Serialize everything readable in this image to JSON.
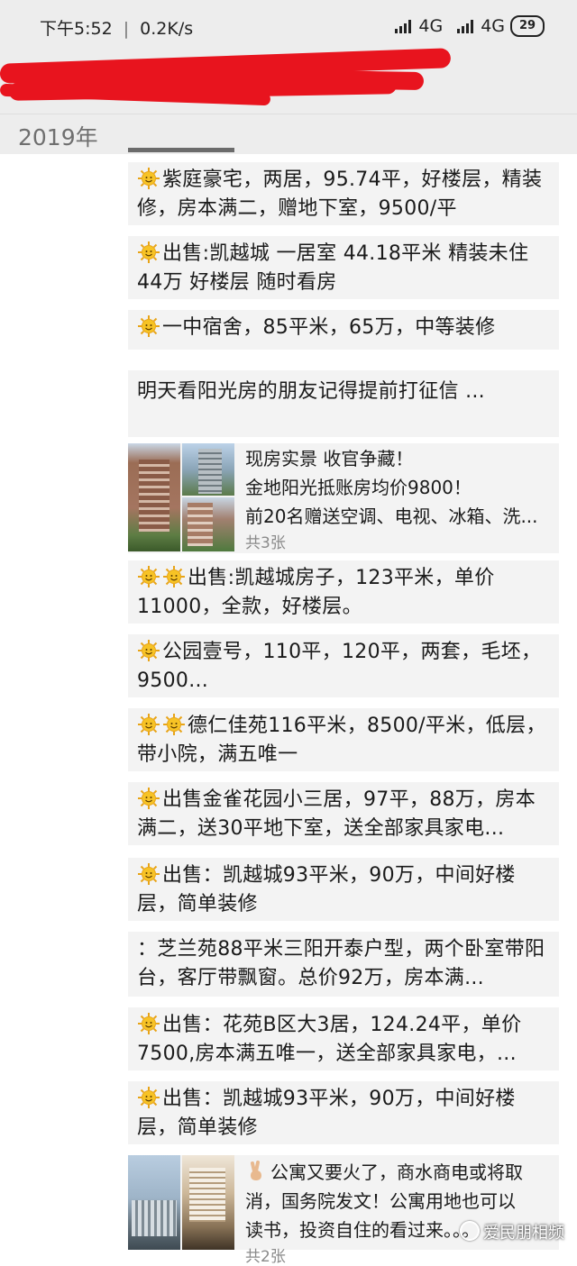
{
  "status_bar": {
    "time": "下午5:52",
    "speed": "0.2K/s",
    "network1": "4G",
    "network2": "4G",
    "battery": "29"
  },
  "year_label": "2019年",
  "posts": [
    {
      "icon": "sun-emoji",
      "icon_count": 1,
      "text": "紫庭豪宅，两居，95.74平，好楼层，精装修，房本满二，赠地下室，9500/平"
    },
    {
      "icon": "sun-emoji",
      "icon_count": 1,
      "text": "出售:凯越城 一居室  44.18平米  精装未住   44万   好楼层   随时看房"
    },
    {
      "icon": "sun-emoji",
      "icon_count": 1,
      "text": "一中宿舍，85平米，65万，中等装修"
    },
    {
      "icon": "",
      "icon_count": 0,
      "text": "明天看阳光房的朋友记得提前打征信 ..."
    },
    {
      "icon": "sun-emoji",
      "icon_count": 2,
      "text": "出售:凯越城房子，123平米，单价11000，全款，好楼层。"
    },
    {
      "icon": "sun-emoji",
      "icon_count": 1,
      "text": "公园壹号，110平，120平，两套，毛坯，9500..."
    },
    {
      "icon": "sun-emoji",
      "icon_count": 2,
      "text": "德仁佳苑116平米，8500/平米，低层，带小院，满五唯一"
    },
    {
      "icon": "sun-emoji",
      "icon_count": 1,
      "text": "出售金雀花园小三居，97平，88万，房本满二，送30平地下室，送全部家具家电..."
    },
    {
      "icon": "sun-emoji",
      "icon_count": 1,
      "text": "出售：凯越城93平米，90万，中间好楼层，简单装修"
    },
    {
      "icon": "",
      "icon_count": 0,
      "text": "：芝兰苑88平米三阳开泰户型，两个卧室带阳台，客厅带飘窗。总价92万，房本满..."
    },
    {
      "icon": "sun-emoji",
      "icon_count": 1,
      "text": "出售：花苑B区大3居，124.24平，单价7500,房本满五唯一，送全部家具家电，..."
    },
    {
      "icon": "sun-emoji",
      "icon_count": 1,
      "text": "出售：凯越城93平米，90万，中间好楼层，简单装修"
    }
  ],
  "photo_posts": [
    {
      "lines": [
        "现房实景  收官争藏！",
        "金地阳光抵账房均价9800！",
        "前20名赠送空调、电视、冰箱、洗..."
      ],
      "count": "共3张"
    },
    {
      "icon": "victory-hand-emoji",
      "lines": [
        "公寓又要火了，商水商电或将取",
        "消，国务院发文！公寓用地也可以",
        "读书，投资自住的看过来。。。"
      ],
      "count": "共2张"
    }
  ],
  "watermark": "爱民朋相频"
}
